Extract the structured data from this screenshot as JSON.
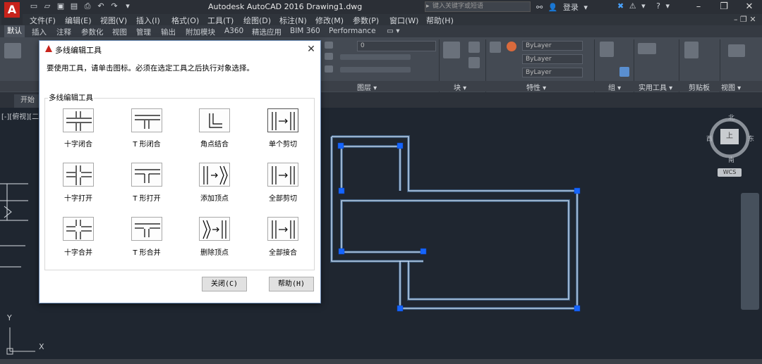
{
  "app": {
    "window_title": "Autodesk AutoCAD 2016    Drawing1.dwg",
    "search_placeholder": "键入关键字或短语",
    "login_label": "登录",
    "logo_letter": "A"
  },
  "menubar": {
    "items": [
      "文件(F)",
      "编辑(E)",
      "视图(V)",
      "插入(I)",
      "格式(O)",
      "工具(T)",
      "绘图(D)",
      "标注(N)",
      "修改(M)",
      "参数(P)",
      "窗口(W)",
      "帮助(H)"
    ]
  },
  "ribbon": {
    "tabs": [
      "默认",
      "插入",
      "注释",
      "参数化",
      "视图",
      "管理",
      "输出",
      "附加模块",
      "A360",
      "精选应用",
      "BIM 360",
      "Performance"
    ],
    "active_tab": "默认",
    "layer_value": "0",
    "color_value": "ByLayer",
    "linetype_value": "ByLayer",
    "lineweight_value": "ByLayer",
    "panels": [
      "图层 ▾",
      "块 ▾",
      "特性 ▾",
      "组 ▾",
      "实用工具 ▾",
      "剪贴板",
      "视图 ▾"
    ]
  },
  "filetabs": {
    "start": "开始"
  },
  "canvas": {
    "viewport_label": "[-][俯视][二",
    "viewcube": {
      "north": "北",
      "south": "南",
      "west": "西",
      "east": "东",
      "top": "上"
    },
    "wcs": "WCS",
    "ucs_y": "Y",
    "ucs_x": "X"
  },
  "dialog": {
    "title": "多线编辑工具",
    "instruction": "要使用工具，请单击图标。必须在选定工具之后执行对象选择。",
    "group_label": "多线编辑工具",
    "tools": [
      {
        "label": "十字闭合",
        "icon": "cross-closed-icon"
      },
      {
        "label": "T 形闭合",
        "icon": "tee-closed-icon"
      },
      {
        "label": "角点结合",
        "icon": "corner-joint-icon"
      },
      {
        "label": "单个剪切",
        "icon": "cut-single-icon"
      },
      {
        "label": "十字打开",
        "icon": "cross-open-icon"
      },
      {
        "label": "T 形打开",
        "icon": "tee-open-icon"
      },
      {
        "label": "添加顶点",
        "icon": "add-vertex-icon"
      },
      {
        "label": "全部剪切",
        "icon": "cut-all-icon"
      },
      {
        "label": "十字合并",
        "icon": "cross-merged-icon"
      },
      {
        "label": "T 形合并",
        "icon": "tee-merged-icon"
      },
      {
        "label": "删除顶点",
        "icon": "delete-vertex-icon"
      },
      {
        "label": "全部接合",
        "icon": "weld-all-icon"
      }
    ],
    "close_button": "关闭(C)",
    "help_button": "帮助(H)"
  },
  "colors": {
    "canvas_bg": "#1f2630",
    "multiline": "#a9d4ff",
    "grip": "#1565ff",
    "autocad_red": "#c8231b"
  }
}
